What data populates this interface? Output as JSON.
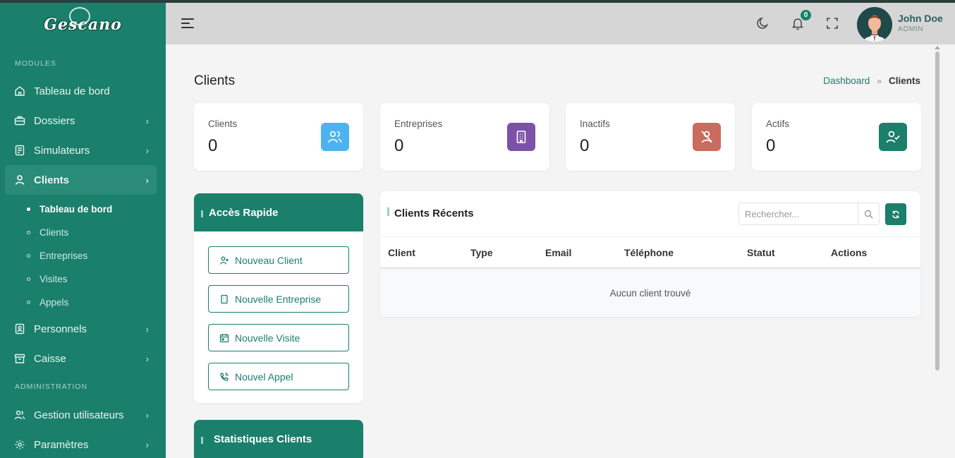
{
  "app": {
    "logo_text": "Gescano"
  },
  "sidebar": {
    "section_modules": "MODULES",
    "section_admin": "ADMINISTRATION",
    "items": [
      {
        "label": "Tableau de bord"
      },
      {
        "label": "Dossiers"
      },
      {
        "label": "Simulateurs"
      },
      {
        "label": "Clients"
      },
      {
        "label": "Personnels"
      },
      {
        "label": "Caisse"
      }
    ],
    "clients_sub": [
      {
        "label": "Tableau de bord"
      },
      {
        "label": "Clients"
      },
      {
        "label": "Entreprises"
      },
      {
        "label": "Visites"
      },
      {
        "label": "Appels"
      }
    ],
    "admin_items": [
      {
        "label": "Gestion utilisateurs"
      },
      {
        "label": "Paramètres"
      }
    ]
  },
  "header": {
    "notifications_count": "0",
    "user_name": "John Doe",
    "user_role": "ADMIN"
  },
  "page": {
    "title": "Clients",
    "breadcrumb": {
      "link": "Dashboard",
      "current": "Clients"
    }
  },
  "stats": [
    {
      "label": "Clients",
      "value": "0",
      "color": "#4db3f0",
      "icon": "users-icon"
    },
    {
      "label": "Entreprises",
      "value": "0",
      "color": "#7b52a8",
      "icon": "building-icon"
    },
    {
      "label": "Inactifs",
      "value": "0",
      "color": "#c96b5e",
      "icon": "user-x-icon"
    },
    {
      "label": "Actifs",
      "value": "0",
      "color": "#1a7f6b",
      "icon": "user-check-icon"
    }
  ],
  "quick_access": {
    "title": "Accès Rapide",
    "buttons": [
      {
        "label": "Nouveau Client"
      },
      {
        "label": "Nouvelle Entreprise"
      },
      {
        "label": "Nouvelle Visite"
      },
      {
        "label": "Nouvel Appel"
      }
    ]
  },
  "stats_panel": {
    "title": "Statistiques Clients"
  },
  "recent": {
    "title": "Clients Récents",
    "search_placeholder": "Rechercher...",
    "columns": [
      "Client",
      "Type",
      "Email",
      "Téléphone",
      "Statut",
      "Actions"
    ],
    "empty_text": "Aucun client trouvé"
  },
  "colors": {
    "primary": "#1a7f6b",
    "header_bg": "#d6d6d6",
    "page_bg": "#f4f4f5"
  }
}
